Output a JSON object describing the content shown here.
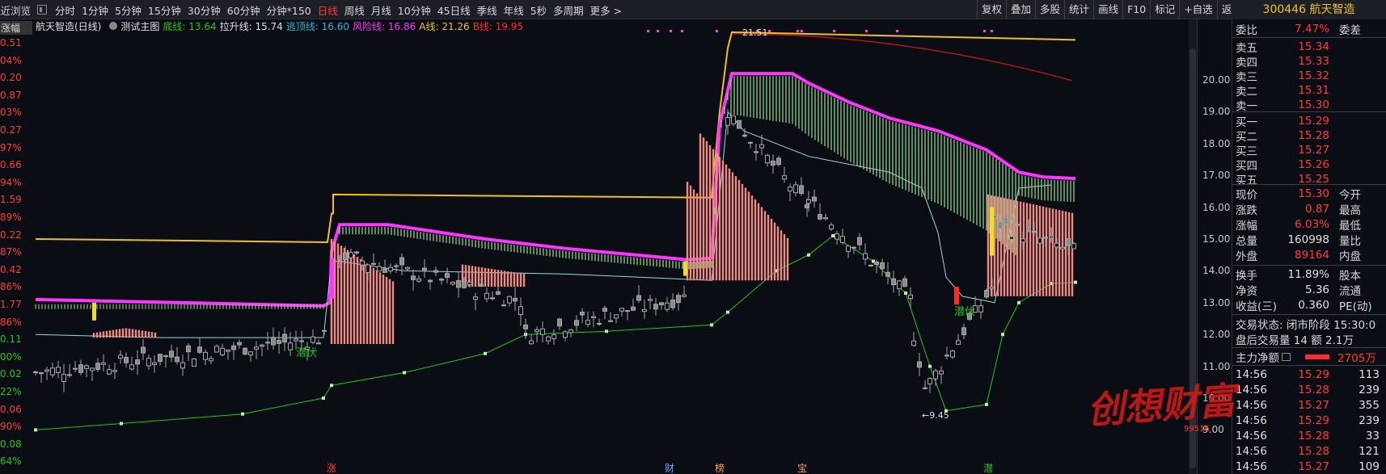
{
  "toolbar": {
    "recent": "最近浏览",
    "periods": [
      "分时",
      "1分钟",
      "5分钟",
      "15分钟",
      "30分钟",
      "60分钟",
      "分钟*150",
      "日线",
      "周线",
      "月线",
      "10分钟",
      "45日线",
      "季线",
      "年线",
      "5秒",
      "多周期",
      "更多 >"
    ],
    "active_period": "日线",
    "tools": [
      "复权",
      "叠加",
      "多股",
      "统计",
      "画线",
      "F10",
      "标记",
      "+自选",
      "返回"
    ]
  },
  "stock": {
    "code": "300446",
    "name": "航天智造"
  },
  "legend": {
    "title": "航天智造(日线)",
    "indicator": "测试主图",
    "items": [
      {
        "label": "底线: 13.64",
        "color": "#19c919"
      },
      {
        "label": "拉升线: 15.74",
        "color": "#e0e0e0"
      },
      {
        "label": "逃顶线: 16.60",
        "color": "#22b8d8"
      },
      {
        "label": "风险线: 16.86",
        "color": "#ff35ff"
      },
      {
        "label": "A线: 21.26",
        "color": "#f0c020"
      },
      {
        "label": "B线: 19.95",
        "color": "#ff2a2a"
      }
    ]
  },
  "left_axis": {
    "header": "涨幅",
    "labels": [
      {
        "t": "0.51",
        "c": "r"
      },
      {
        "t": "04%",
        "c": "r"
      },
      {
        "t": "0.20",
        "c": "r"
      },
      {
        "t": "0.87",
        "c": "r"
      },
      {
        "t": "03%",
        "c": "r"
      },
      {
        "t": "0.27",
        "c": "r"
      },
      {
        "t": "97%",
        "c": "r"
      },
      {
        "t": "0.66",
        "c": "r"
      },
      {
        "t": "94%",
        "c": "r"
      },
      {
        "t": "1.59",
        "c": "r"
      },
      {
        "t": "89%",
        "c": "r"
      },
      {
        "t": "0.22",
        "c": "r"
      },
      {
        "t": "87%",
        "c": "r"
      },
      {
        "t": "0.42",
        "c": "r"
      },
      {
        "t": "86%",
        "c": "r"
      },
      {
        "t": "1.77",
        "c": "r"
      },
      {
        "t": "86%",
        "c": "r"
      },
      {
        "t": "0.11",
        "c": "g"
      },
      {
        "t": "00%",
        "c": "g"
      },
      {
        "t": "0.02",
        "c": "g"
      },
      {
        "t": "22%",
        "c": "g"
      },
      {
        "t": "0.06",
        "c": "r"
      },
      {
        "t": "90%",
        "c": "r"
      },
      {
        "t": "0.08",
        "c": "g"
      },
      {
        "t": "64%",
        "c": "g"
      }
    ]
  },
  "right_axis": [
    "20.00",
    "19.00",
    "18.00",
    "17.00",
    "16.00",
    "15.00",
    "14.00",
    "13.00",
    "12.00",
    "11.00",
    "10.00",
    "9.00"
  ],
  "chart_labels": {
    "high": "21.51",
    "low": "←9.45",
    "signal1": "潜伏",
    "signal2": "潜伏",
    "markers": [
      "涨",
      "财",
      "榜",
      "宝",
      "潜"
    ]
  },
  "panel": {
    "weibi_label": "委比",
    "weibi_value": "7.47%",
    "weicha_label": "委差",
    "asks": [
      {
        "label": "卖五",
        "price": "15.34"
      },
      {
        "label": "卖四",
        "price": "15.33"
      },
      {
        "label": "卖三",
        "price": "15.32"
      },
      {
        "label": "卖二",
        "price": "15.31"
      },
      {
        "label": "卖一",
        "price": "15.30"
      }
    ],
    "bids": [
      {
        "label": "买一",
        "price": "15.29"
      },
      {
        "label": "买二",
        "price": "15.28"
      },
      {
        "label": "买三",
        "price": "15.27"
      },
      {
        "label": "买四",
        "price": "15.26"
      },
      {
        "label": "买五",
        "price": "15.25"
      }
    ],
    "quote": [
      {
        "l": "现价",
        "v": "15.30",
        "vc": "red",
        "r": "今开"
      },
      {
        "l": "涨跌",
        "v": "0.87",
        "vc": "red",
        "r": "最高"
      },
      {
        "l": "涨幅",
        "v": "6.03%",
        "vc": "red",
        "r": "最低"
      },
      {
        "l": "总量",
        "v": "160998",
        "vc": "white",
        "r": "量比"
      },
      {
        "l": "外盘",
        "v": "89164",
        "vc": "red",
        "r": "内盘"
      }
    ],
    "fund": [
      {
        "l": "换手",
        "v": "11.89%",
        "r": "股本"
      },
      {
        "l": "净资",
        "v": "5.36",
        "r": "流通"
      },
      {
        "l": "收益(三)",
        "v": "0.360",
        "r": "PE(动)"
      }
    ],
    "status": "交易状态: 闭市阶段 15:30:0",
    "after_hours": "盘后交易量 14 额 2.1万",
    "main_flow_label": "主力净额",
    "main_flow_value": "2705万",
    "ticks": [
      {
        "t": "14:56",
        "p": "15.29",
        "v": "113"
      },
      {
        "t": "14:56",
        "p": "15.28",
        "v": "239"
      },
      {
        "t": "14:56",
        "p": "15.27",
        "v": "355"
      },
      {
        "t": "14:56",
        "p": "15.29",
        "v": "239"
      },
      {
        "t": "14:56",
        "p": "15.28",
        "v": "33"
      },
      {
        "t": "14:56",
        "p": "15.28",
        "v": "121"
      },
      {
        "t": "14:56",
        "p": "15.27",
        "v": "109"
      }
    ],
    "watermark": "创想财富",
    "watermark_sub": "99516"
  }
}
